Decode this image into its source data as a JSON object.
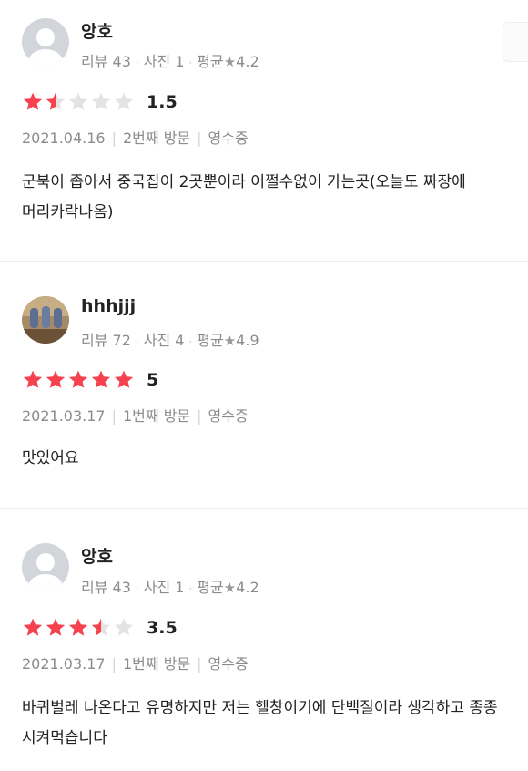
{
  "reviews": [
    {
      "nickname": "앙호",
      "avatar": "default-avatar",
      "stats": {
        "review_label": "리뷰 43",
        "photo_label": "사진 1",
        "avg_prefix": "평균",
        "avg_value": "4.2"
      },
      "rating": 1.5,
      "score_text": "1.5",
      "date": "2021.04.16",
      "visit": "2번째 방문",
      "receipt": "영수증",
      "text": "군북이 좁아서 중국집이 2곳뿐이라 어쩔수없이 가는곳(오늘도 짜장에 머리카락나옴)"
    },
    {
      "nickname": "hhhjjj",
      "avatar": "photo-avatar",
      "stats": {
        "review_label": "리뷰 72",
        "photo_label": "사진 4",
        "avg_prefix": "평균",
        "avg_value": "4.9"
      },
      "rating": 5,
      "score_text": "5",
      "date": "2021.03.17",
      "visit": "1번째 방문",
      "receipt": "영수증",
      "text": "맛있어요"
    },
    {
      "nickname": "앙호",
      "avatar": "default-avatar",
      "stats": {
        "review_label": "리뷰 43",
        "photo_label": "사진 1",
        "avg_prefix": "평균",
        "avg_value": "4.2"
      },
      "rating": 3.5,
      "score_text": "3.5",
      "date": "2021.03.17",
      "visit": "1번째 방문",
      "receipt": "영수증",
      "text": "바퀴벌레 나온다고 유명하지만 저는 헬창이기에 단백질이라 생각하고 종종 시켜먹습니다"
    }
  ],
  "colors": {
    "star_filled": "#f5424e",
    "star_empty": "#e3e3e3",
    "meta": "#8c8c8c"
  },
  "icons": {
    "star": "star-icon",
    "avatar_default": "person-silhouette-icon"
  }
}
